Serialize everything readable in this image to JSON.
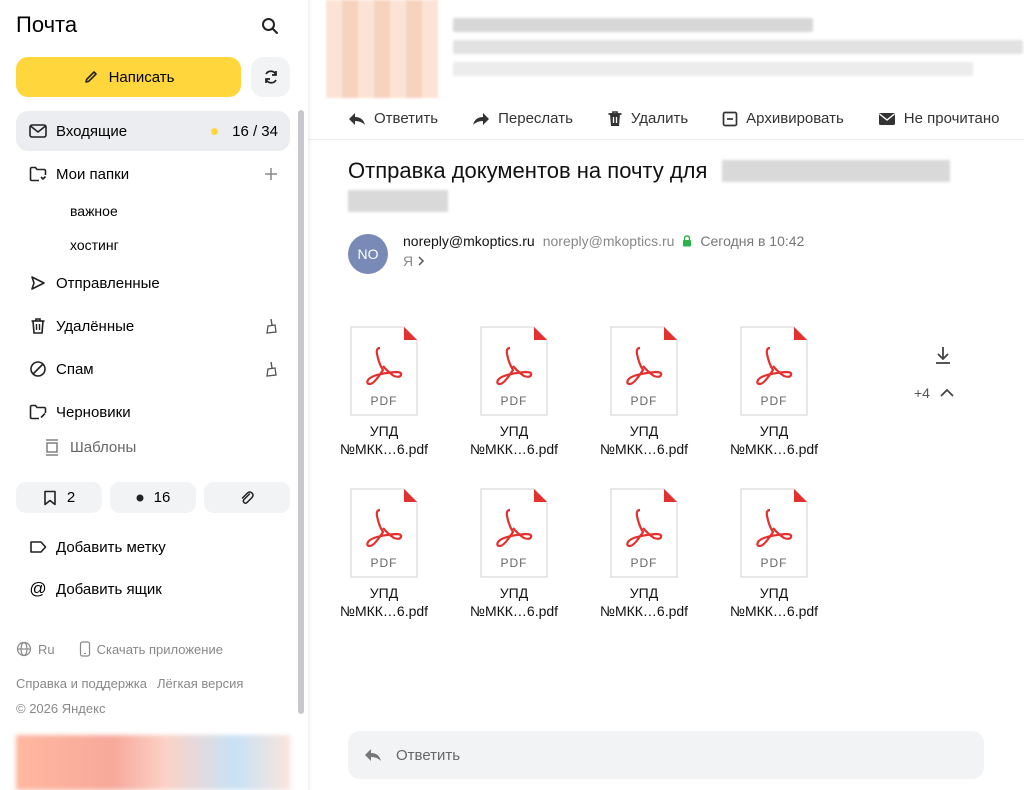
{
  "app": {
    "title": "Почта"
  },
  "sidebar": {
    "compose_label": "Написать",
    "nav": [
      {
        "label": "Входящие",
        "count": "16 / 34"
      },
      {
        "label": "Мои папки"
      },
      {
        "label": "Отправленные"
      },
      {
        "label": "Удалённые"
      },
      {
        "label": "Спам"
      },
      {
        "label": "Черновики"
      }
    ],
    "subfolders": [
      "важное",
      "хостинг"
    ],
    "templates_label": "Шаблоны",
    "chips": [
      {
        "icon": "bookmark-icon",
        "value": "2"
      },
      {
        "icon": "unread-dot-icon",
        "value": "16"
      },
      {
        "icon": "paperclip-icon",
        "value": ""
      }
    ],
    "add_label": "Добавить метку",
    "add_mailbox": "Добавить ящик",
    "lang": "Ru",
    "download_app": "Скачать приложение",
    "help": "Справка и поддержка",
    "light_version": "Лёгкая версия",
    "copyright": "© 2026 Яндекс"
  },
  "toolbar": {
    "reply": "Ответить",
    "forward": "Переслать",
    "delete": "Удалить",
    "archive": "Архивировать",
    "unread": "Не прочитано"
  },
  "message": {
    "subject": "Отправка документов на почту для",
    "avatar_initials": "NO",
    "sender_name": "noreply@mkoptics.ru",
    "sender_address": "noreply@mkoptics.ru",
    "date": "Сегодня в 10:42",
    "recipient": "Я",
    "attachments": [
      {
        "type": "PDF",
        "line1": "УПД",
        "line2": "№МКК…6.pdf"
      },
      {
        "type": "PDF",
        "line1": "УПД",
        "line2": "№МКК…6.pdf"
      },
      {
        "type": "PDF",
        "line1": "УПД",
        "line2": "№МКК…6.pdf"
      },
      {
        "type": "PDF",
        "line1": "УПД",
        "line2": "№МКК…6.pdf"
      },
      {
        "type": "PDF",
        "line1": "УПД",
        "line2": "№МКК…6.pdf"
      },
      {
        "type": "PDF",
        "line1": "УПД",
        "line2": "№МКК…6.pdf"
      },
      {
        "type": "PDF",
        "line1": "УПД",
        "line2": "№МКК…6.pdf"
      },
      {
        "type": "PDF",
        "line1": "УПД",
        "line2": "№МКК…6.pdf"
      }
    ],
    "more_attachments": "+4"
  },
  "reply_box": {
    "placeholder": "Ответить"
  },
  "colors": {
    "accent": "#ffd73c",
    "pdf_red": "#e3312f",
    "avatar": "#7a8ab7",
    "secure": "#2bb34b"
  }
}
